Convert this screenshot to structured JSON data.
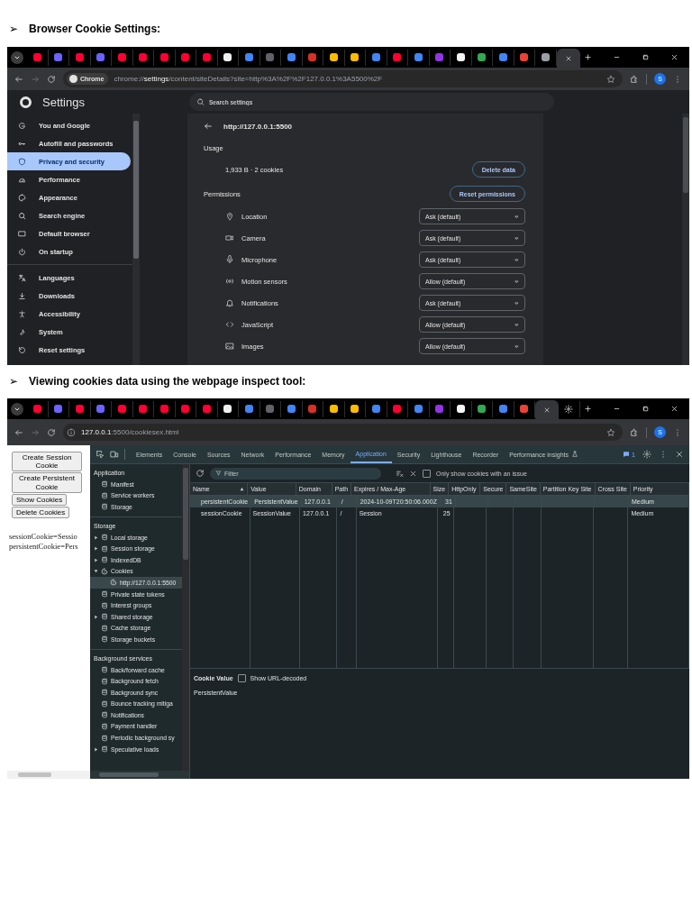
{
  "heading_1": {
    "bullet": "➢",
    "text": "Browser Cookie Settings:"
  },
  "screenshot_1": {
    "browser": {
      "tabs": [
        {
          "kind": "site",
          "color": "#ff0033",
          "selected": false
        },
        {
          "kind": "site",
          "color": "#6c63ff",
          "selected": false
        },
        {
          "kind": "site",
          "color": "#ff0033",
          "selected": false
        },
        {
          "kind": "site",
          "color": "#6c63ff",
          "selected": false
        },
        {
          "kind": "site",
          "color": "#ff0033",
          "selected": false
        },
        {
          "kind": "site",
          "color": "#ff0033",
          "selected": false
        },
        {
          "kind": "site",
          "color": "#ff0033",
          "selected": false
        },
        {
          "kind": "site",
          "color": "#ff0033",
          "selected": false
        },
        {
          "kind": "site",
          "color": "#ff0033",
          "selected": false
        },
        {
          "kind": "site",
          "color": "#f0f0f0",
          "selected": false
        },
        {
          "kind": "site",
          "color": "#4285f4",
          "selected": false
        },
        {
          "kind": "site",
          "color": "#5f6368",
          "selected": false
        },
        {
          "kind": "site",
          "color": "#4285f4",
          "selected": false
        },
        {
          "kind": "site",
          "color": "#d93025",
          "selected": false
        },
        {
          "kind": "site",
          "color": "#fbbc04",
          "selected": false
        },
        {
          "kind": "site",
          "color": "#fbbc04",
          "selected": false
        },
        {
          "kind": "site",
          "color": "#4285f4",
          "selected": false
        },
        {
          "kind": "site",
          "color": "#ff0033",
          "selected": false
        },
        {
          "kind": "site",
          "color": "#4285f4",
          "selected": false
        },
        {
          "kind": "site",
          "color": "#9334e6",
          "selected": false
        },
        {
          "kind": "site",
          "color": "#f5f5f5",
          "selected": false
        },
        {
          "kind": "site",
          "color": "#34a853",
          "selected": false
        },
        {
          "kind": "site",
          "color": "#4285f4",
          "selected": false
        },
        {
          "kind": "site",
          "color": "#ea4335",
          "selected": false
        },
        {
          "kind": "site",
          "color": "#9aa0a6",
          "selected": false
        },
        {
          "kind": "settings",
          "selected": true
        }
      ],
      "address": {
        "chip": "Chrome",
        "url": "chrome://**settings**/content/siteDetails?site=http%3A%2F%2F127.0.0.1%3A5500%2F"
      },
      "profile": "S"
    },
    "settings": {
      "title": "Settings",
      "search": {
        "placeholder": "Search settings"
      },
      "sidebar": {
        "groups": [
          {
            "items": [
              {
                "label": "You and Google",
                "selected": false
              },
              {
                "label": "Autofill and passwords",
                "selected": false
              },
              {
                "label": "Privacy and security",
                "selected": true
              },
              {
                "label": "Performance",
                "selected": false
              },
              {
                "label": "Appearance",
                "selected": false
              },
              {
                "label": "Search engine",
                "selected": false
              },
              {
                "label": "Default browser",
                "selected": false
              },
              {
                "label": "On startup",
                "selected": false
              }
            ]
          },
          {
            "items": [
              {
                "label": "Languages",
                "selected": false
              },
              {
                "label": "Downloads",
                "selected": false
              },
              {
                "label": "Accessibility",
                "selected": false
              },
              {
                "label": "System",
                "selected": false
              },
              {
                "label": "Reset settings",
                "selected": false
              }
            ]
          }
        ]
      },
      "site": "http://127.0.0.1:5500",
      "usage": {
        "label": "Usage",
        "summary": "1,933 B · 2 cookies",
        "button": "Delete data"
      },
      "permissions": {
        "label": "Permissions",
        "button": "Reset permissions",
        "rows": [
          {
            "name": "Location",
            "value": "Ask (default)"
          },
          {
            "name": "Camera",
            "value": "Ask (default)"
          },
          {
            "name": "Microphone",
            "value": "Ask (default)"
          },
          {
            "name": "Motion sensors",
            "value": "Allow (default)"
          },
          {
            "name": "Notifications",
            "value": "Ask (default)"
          },
          {
            "name": "JavaScript",
            "value": "Allow (default)"
          },
          {
            "name": "Images",
            "value": "Allow (default)"
          }
        ]
      }
    }
  },
  "heading_2": {
    "bullet": "➢",
    "text": "Viewing cookies data using the webpage inspect tool:"
  },
  "screenshot_2": {
    "browser": {
      "tabs": [
        {
          "kind": "site",
          "color": "#ff0033",
          "selected": false
        },
        {
          "kind": "site",
          "color": "#6c63ff",
          "selected": false
        },
        {
          "kind": "site",
          "color": "#ff0033",
          "selected": false
        },
        {
          "kind": "site",
          "color": "#6c63ff",
          "selected": false
        },
        {
          "kind": "site",
          "color": "#ff0033",
          "selected": false
        },
        {
          "kind": "site",
          "color": "#ff0033",
          "selected": false
        },
        {
          "kind": "site",
          "color": "#ff0033",
          "selected": false
        },
        {
          "kind": "site",
          "color": "#ff0033",
          "selected": false
        },
        {
          "kind": "site",
          "color": "#ff0033",
          "selected": false
        },
        {
          "kind": "site",
          "color": "#f0f0f0",
          "selected": false
        },
        {
          "kind": "site",
          "color": "#4285f4",
          "selected": false
        },
        {
          "kind": "site",
          "color": "#5f6368",
          "selected": false
        },
        {
          "kind": "site",
          "color": "#4285f4",
          "selected": false
        },
        {
          "kind": "site",
          "color": "#d93025",
          "selected": false
        },
        {
          "kind": "site",
          "color": "#fbbc04",
          "selected": false
        },
        {
          "kind": "site",
          "color": "#fbbc04",
          "selected": false
        },
        {
          "kind": "site",
          "color": "#4285f4",
          "selected": false
        },
        {
          "kind": "site",
          "color": "#ff0033",
          "selected": false
        },
        {
          "kind": "site",
          "color": "#4285f4",
          "selected": false
        },
        {
          "kind": "site",
          "color": "#9334e6",
          "selected": false
        },
        {
          "kind": "site",
          "color": "#f5f5f5",
          "selected": false
        },
        {
          "kind": "site",
          "color": "#34a853",
          "selected": false
        },
        {
          "kind": "site",
          "color": "#4285f4",
          "selected": false
        },
        {
          "kind": "site",
          "color": "#ea4335",
          "selected": false
        },
        {
          "kind": "site",
          "selected": true
        },
        {
          "kind": "settings",
          "selected": false
        }
      ],
      "address": {
        "url": "**127.0.0.1**:5500/cookiesex.html"
      },
      "profile": "S"
    },
    "page": {
      "buttons": [
        "Create Session Cookie",
        "Create Persistent Cookie",
        "Show Cookies",
        "Delete Cookies"
      ],
      "output": [
        "sessionCookie=Sessio",
        "persistentCookie=Pers"
      ]
    },
    "devtools": {
      "tabs": [
        {
          "label": "Elements",
          "selected": false,
          "experimental": false
        },
        {
          "label": "Console",
          "selected": false,
          "experimental": false
        },
        {
          "label": "Sources",
          "selected": false,
          "experimental": false
        },
        {
          "label": "Network",
          "selected": false,
          "experimental": false
        },
        {
          "label": "Performance",
          "selected": false,
          "experimental": false
        },
        {
          "label": "Memory",
          "selected": false,
          "experimental": false
        },
        {
          "label": "Application",
          "selected": true,
          "experimental": false
        },
        {
          "label": "Security",
          "selected": false,
          "experimental": false
        },
        {
          "label": "Lighthouse",
          "selected": false,
          "experimental": false
        },
        {
          "label": "Recorder",
          "selected": false,
          "experimental": false
        },
        {
          "label": "Performance insights",
          "selected": false,
          "experimental": true
        }
      ],
      "issues_badge": "1",
      "sidebar": {
        "sections": [
          {
            "title": "Application",
            "items": [
              {
                "label": "Manifest",
                "selected": false
              },
              {
                "label": "Service workers",
                "selected": false
              },
              {
                "label": "Storage",
                "selected": false
              }
            ]
          },
          {
            "title": "Storage",
            "items": [
              {
                "label": "Local storage",
                "expanded": false,
                "selected": false
              },
              {
                "label": "Session storage",
                "expanded": false,
                "selected": false
              },
              {
                "label": "IndexedDB",
                "expanded": false,
                "selected": false
              },
              {
                "label": "Cookies",
                "expanded": true,
                "selected": false,
                "children": [
                  {
                    "label": "http://127.0.0.1:5500",
                    "selected": true
                  }
                ]
              },
              {
                "label": "Private state tokens",
                "selected": false
              },
              {
                "label": "Interest groups",
                "selected": false
              },
              {
                "label": "Shared storage",
                "expanded": false,
                "selected": false
              },
              {
                "label": "Cache storage",
                "selected": false
              },
              {
                "label": "Storage buckets",
                "selected": false
              }
            ]
          },
          {
            "title": "Background services",
            "items": [
              {
                "label": "Back/forward cache",
                "selected": false
              },
              {
                "label": "Background fetch",
                "selected": false
              },
              {
                "label": "Background sync",
                "selected": false
              },
              {
                "label": "Bounce tracking mitiga",
                "selected": false
              },
              {
                "label": "Notifications",
                "selected": false
              },
              {
                "label": "Payment handler",
                "selected": false
              },
              {
                "label": "Periodic background sy",
                "selected": false
              },
              {
                "label": "Speculative loads",
                "expanded": false,
                "selected": false
              }
            ]
          }
        ]
      },
      "toolbar": {
        "filter": {
          "placeholder": "Filter"
        },
        "issue_filter": {
          "label": "Only show cookies with an issue",
          "checked": false
        }
      },
      "table": {
        "columns": [
          {
            "label": "Name",
            "sorted": true
          },
          {
            "label": "Value",
            "sorted": false
          },
          {
            "label": "Domain",
            "sorted": false
          },
          {
            "label": "Path",
            "sorted": false
          },
          {
            "label": "Expires / Max-Age",
            "sorted": false
          },
          {
            "label": "Size",
            "sorted": false
          },
          {
            "label": "HttpOnly",
            "sorted": false
          },
          {
            "label": "Secure",
            "sorted": false
          },
          {
            "label": "SameSite",
            "sorted": false
          },
          {
            "label": "Partition Key Site",
            "sorted": false
          },
          {
            "label": "Cross Site",
            "sorted": false
          },
          {
            "label": "Priority",
            "sorted": false
          }
        ],
        "rows": [
          {
            "cells": [
              "persistentCookie",
              "PersistentValue",
              "127.0.0.1",
              "/",
              "2024-10-09T20:50:06.000Z",
              "31",
              null,
              null,
              null,
              null,
              null,
              "Medium"
            ],
            "selected": true
          },
          {
            "cells": [
              "sessionCookie",
              "SessionValue",
              "127.0.0.1",
              "/",
              "Session",
              "25",
              null,
              null,
              null,
              null,
              null,
              "Medium"
            ],
            "selected": false
          }
        ]
      },
      "cookie_value": {
        "title": "Cookie Value",
        "decode": {
          "label": "Show URL-decoded",
          "checked": false
        },
        "value": "PersistentValue"
      }
    }
  }
}
